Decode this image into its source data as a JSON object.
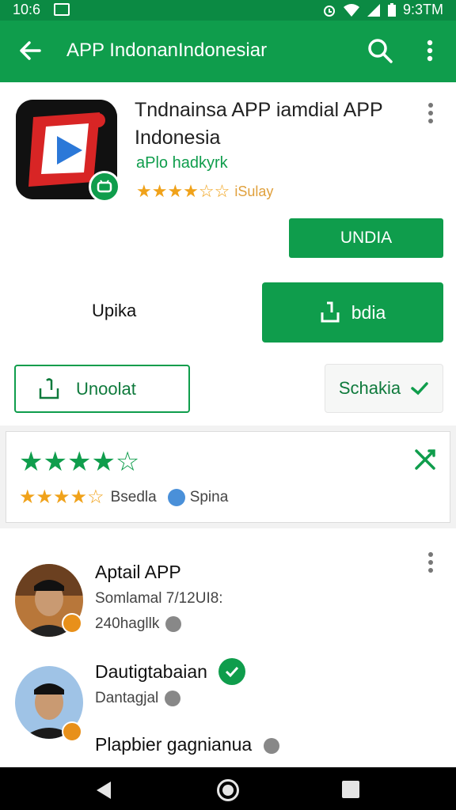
{
  "status_bar": {
    "time": "10:6",
    "clock": "9:3TM"
  },
  "toolbar": {
    "title": "APP IndonanIndonesiar"
  },
  "app": {
    "title": "Tndnainsa APP iamdial APP Indonesia",
    "developer": "aPlo hadkyrk",
    "rating_label": "iSulay",
    "install_button": "UNDIA",
    "secondary_label": "Upika",
    "primary_button": "bdia",
    "outline_button": "Unoolat",
    "schakia_button": "Schakia"
  },
  "rating": {
    "row_label": "Bsedla",
    "spin_label": "Spina"
  },
  "reviews": [
    {
      "name": "Aptail APP",
      "line1": "Somlamal 7/12UI8:",
      "line2": "240hagllk"
    },
    {
      "name": "Dautigtabaian",
      "line1": "Dantagjal",
      "line2": "Plapbier gagnianua"
    }
  ],
  "colors": {
    "primary": "#0f9d4c",
    "toolbar": "#0f9d4c",
    "star": "#f0a21a"
  }
}
